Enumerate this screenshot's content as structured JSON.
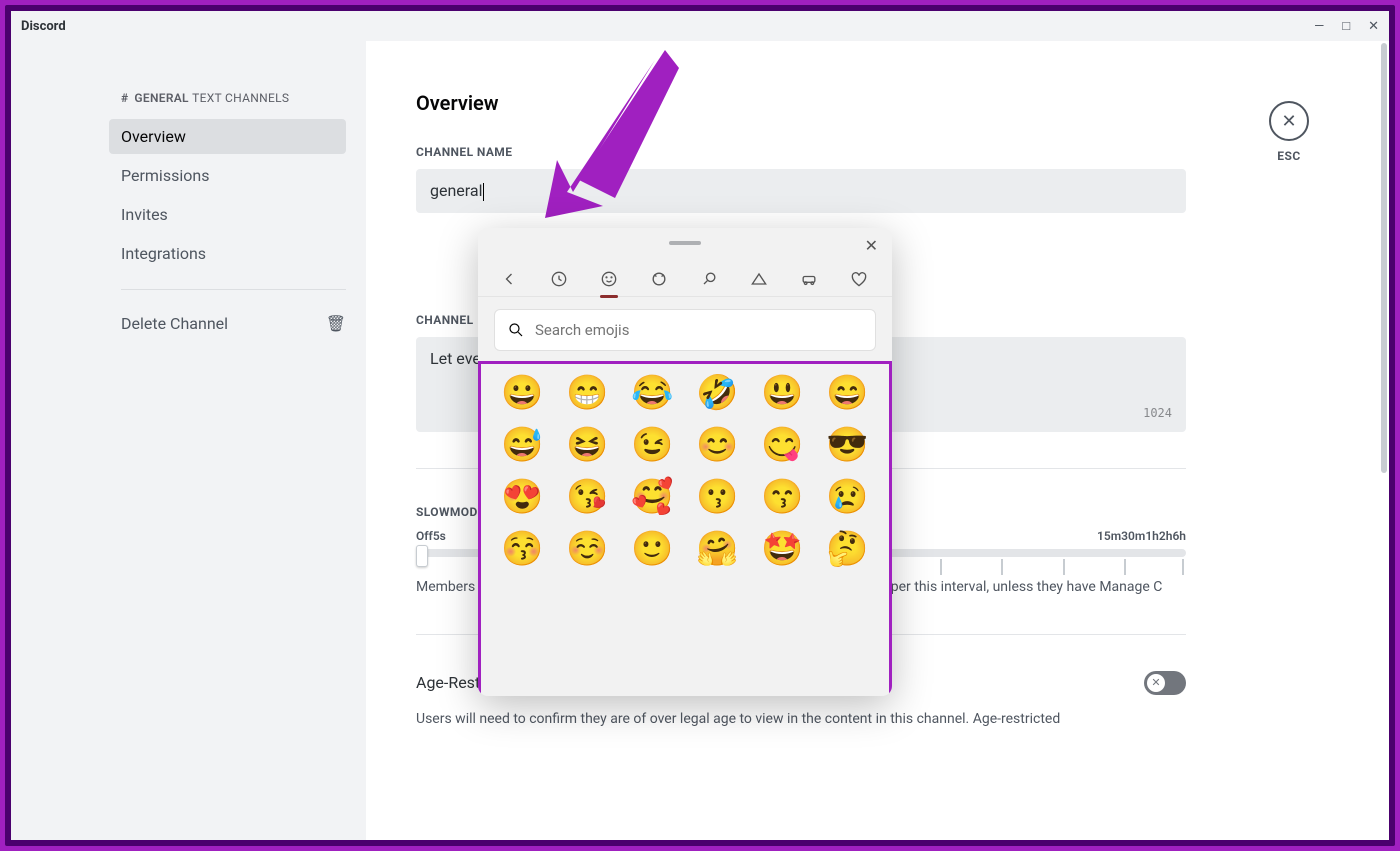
{
  "app": {
    "name": "Discord"
  },
  "window_controls": {
    "min": "—",
    "max": "□",
    "close": "✕"
  },
  "sidebar": {
    "breadcrumb_hash": "#",
    "breadcrumb_channel": "GENERAL",
    "breadcrumb_category": "TEXT CHANNELS",
    "items": [
      "Overview",
      "Permissions",
      "Invites",
      "Integrations"
    ],
    "delete_label": "Delete Channel"
  },
  "close": {
    "label": "ESC"
  },
  "page": {
    "title": "Overview",
    "channel_name_label": "CHANNEL NAME",
    "channel_name_value": "general",
    "channel_topic_label": "CHANNEL",
    "channel_topic_value": "Let eve",
    "charcount": "1024",
    "slowmode_label": "SLOWMOD",
    "slowmode_desc": "Members will be restricted to sending one message and creating one thread per this interval, unless they have Manage C",
    "slider_labels": [
      "Off",
      "5s",
      "",
      "",
      "15m",
      "30m",
      "1h",
      "2h",
      "6h"
    ],
    "age_title": "Age-Restricted Channel",
    "age_desc": "Users will need to confirm they are of over legal age to view in the content in this channel. Age-restricted"
  },
  "picker": {
    "search_placeholder": "Search emojis",
    "emojis": [
      "😀",
      "😁",
      "😂",
      "🤣",
      "😃",
      "😄",
      "😅",
      "😆",
      "😉",
      "😊",
      "😋",
      "😎",
      "😍",
      "😘",
      "🥰",
      "😗",
      "😙",
      "😢",
      "😚",
      "☺️",
      "🙂",
      "🤗",
      "🤩",
      "🤔"
    ]
  },
  "colors": {
    "accent": "#a020c0",
    "border": "#4b006e"
  }
}
